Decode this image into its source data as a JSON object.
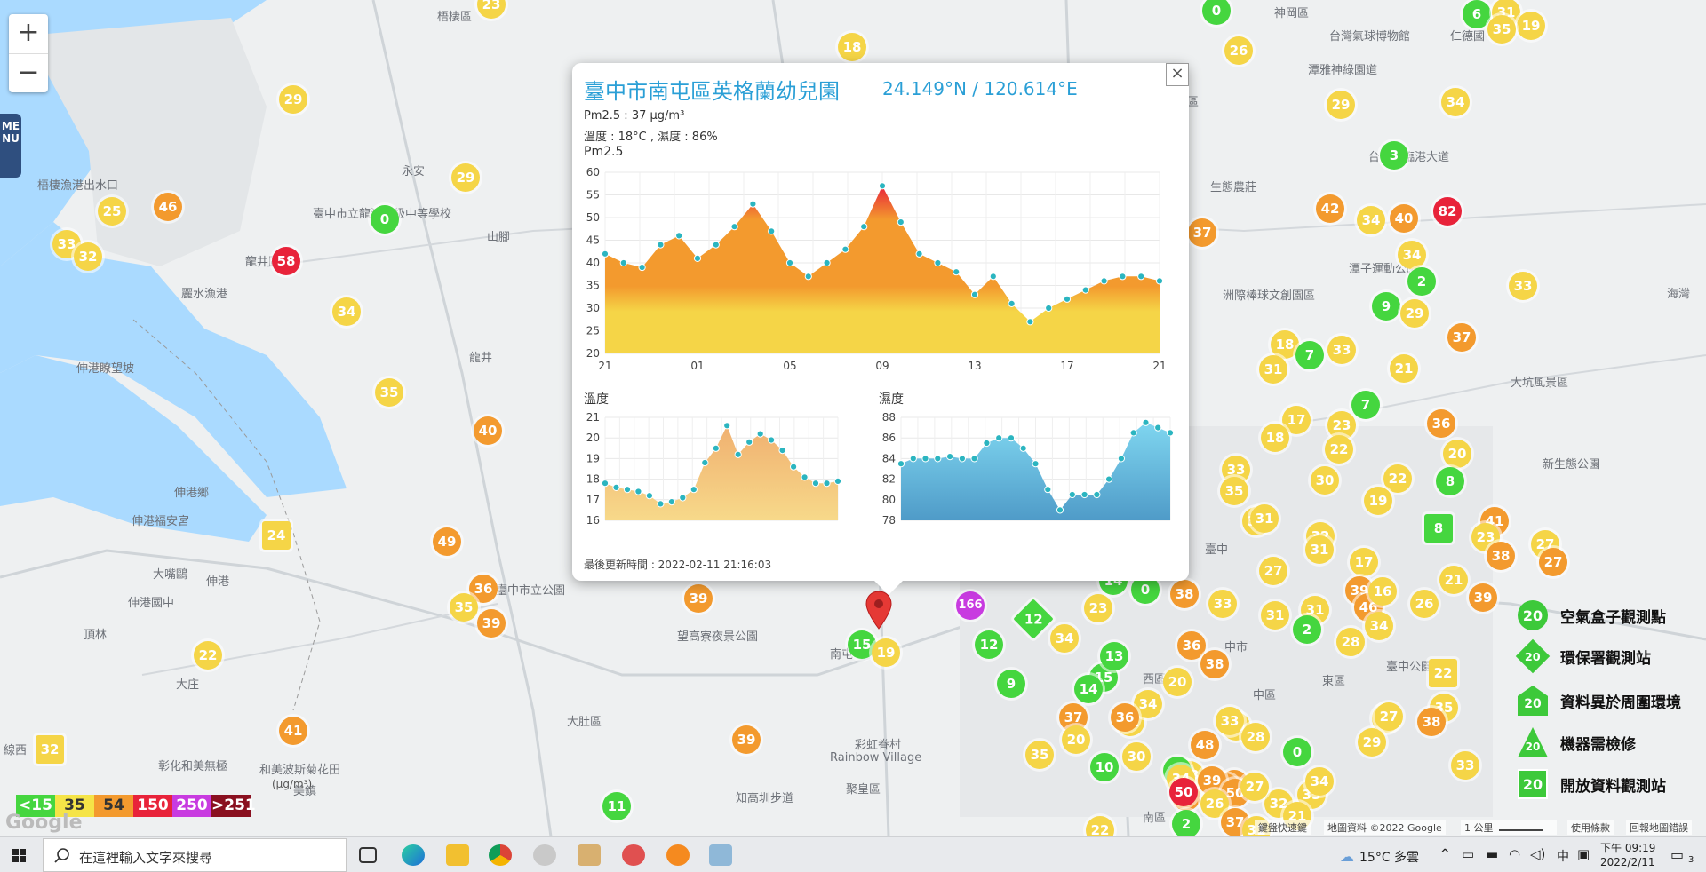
{
  "map": {
    "zoom_in": "+",
    "zoom_out": "−",
    "menu_label": "MENU",
    "place_labels": [
      {
        "name": "梧棲區"
      },
      {
        "name": "神岡區"
      },
      {
        "name": "台灣氣球博物館"
      },
      {
        "name": "仁德國"
      },
      {
        "name": "潭雅神綠園道"
      },
      {
        "name": "生態農莊"
      },
      {
        "name": "台中港臨港大道"
      },
      {
        "name": "梧棲漁港出水口"
      },
      {
        "name": "永安"
      },
      {
        "name": "龍井區"
      },
      {
        "name": "臺中市立龍津高級中等學校"
      },
      {
        "name": "麗水漁港"
      },
      {
        "name": "山腳"
      },
      {
        "name": "龍井"
      },
      {
        "name": "伸港瞭望坡"
      },
      {
        "name": "洲際棒球文創園區"
      },
      {
        "name": "潭子運動公園"
      },
      {
        "name": "伸港鄉"
      },
      {
        "name": "伸港福安宮"
      },
      {
        "name": "大嘴鷗"
      },
      {
        "name": "伸港"
      },
      {
        "name": "伸港國中"
      },
      {
        "name": "頂林"
      },
      {
        "name": "大庄"
      },
      {
        "name": "望高寮夜景公園"
      },
      {
        "name": "南屯"
      },
      {
        "name": "大肚區"
      },
      {
        "name": "彩虹眷村"
      },
      {
        "name": "Rainbow Village"
      },
      {
        "name": "聚皇區"
      },
      {
        "name": "知高圳步道"
      },
      {
        "name": "彰化和美無極"
      },
      {
        "name": "和美波斯菊花田"
      },
      {
        "name": "線西"
      },
      {
        "name": "美鎮"
      },
      {
        "name": "臺中"
      },
      {
        "name": "中市"
      },
      {
        "name": "西區"
      },
      {
        "name": "中區"
      },
      {
        "name": "東區"
      },
      {
        "name": "南區"
      },
      {
        "name": "大坑風景區"
      },
      {
        "name": "新生態公園"
      },
      {
        "name": "臺中公園"
      },
      {
        "name": "海灣"
      },
      {
        "name": "北屯區"
      },
      {
        "name": "臺中市立公園"
      }
    ],
    "markers": [
      {
        "v": "23",
        "c": "#f5d547",
        "s": "circle"
      },
      {
        "v": "0",
        "c": "#45d63f",
        "s": "circle"
      },
      {
        "v": "6",
        "c": "#45d63f",
        "s": "circle"
      },
      {
        "v": "31",
        "c": "#f5d547",
        "s": "circle"
      },
      {
        "v": "19",
        "c": "#f5d547",
        "s": "circle"
      },
      {
        "v": "35",
        "c": "#f5d547",
        "s": "circle"
      },
      {
        "v": "26",
        "c": "#f5d547",
        "s": "circle"
      },
      {
        "v": "18",
        "c": "#f5d547",
        "s": "circle"
      },
      {
        "v": "29",
        "c": "#f5d547",
        "s": "circle"
      },
      {
        "v": "29",
        "c": "#f5d547",
        "s": "circle"
      },
      {
        "v": "34",
        "c": "#f5d547",
        "s": "circle"
      },
      {
        "v": "3",
        "c": "#45d63f",
        "s": "circle"
      },
      {
        "v": "29",
        "c": "#f5d547",
        "s": "circle"
      },
      {
        "v": "25",
        "c": "#f5d547",
        "s": "circle"
      },
      {
        "v": "46",
        "c": "#f39a2e",
        "s": "circle"
      },
      {
        "v": "0",
        "c": "#45d63f",
        "s": "circle"
      },
      {
        "v": "33",
        "c": "#f5d547",
        "s": "circle"
      },
      {
        "v": "32",
        "c": "#f5d547",
        "s": "circle"
      },
      {
        "v": "58",
        "c": "#e8233a",
        "s": "circle"
      },
      {
        "v": "34",
        "c": "#f5d547",
        "s": "circle"
      },
      {
        "v": "35",
        "c": "#f5d547",
        "s": "circle"
      },
      {
        "v": "40",
        "c": "#f39a2e",
        "s": "circle"
      },
      {
        "v": "42",
        "c": "#f39a2e",
        "s": "circle"
      },
      {
        "v": "34",
        "c": "#f5d547",
        "s": "circle"
      },
      {
        "v": "40",
        "c": "#f39a2e",
        "s": "circle"
      },
      {
        "v": "82",
        "c": "#e8233a",
        "s": "circle"
      },
      {
        "v": "37",
        "c": "#f39a2e",
        "s": "circle"
      },
      {
        "v": "34",
        "c": "#f5d547",
        "s": "circle"
      },
      {
        "v": "2",
        "c": "#45d63f",
        "s": "circle"
      },
      {
        "v": "9",
        "c": "#45d63f",
        "s": "circle"
      },
      {
        "v": "29",
        "c": "#f5d547",
        "s": "circle"
      },
      {
        "v": "33",
        "c": "#f5d547",
        "s": "circle"
      },
      {
        "v": "37",
        "c": "#f39a2e",
        "s": "circle"
      },
      {
        "v": "18",
        "c": "#f5d547",
        "s": "circle"
      },
      {
        "v": "7",
        "c": "#45d63f",
        "s": "circle"
      },
      {
        "v": "33",
        "c": "#f5d547",
        "s": "circle"
      },
      {
        "v": "21",
        "c": "#f5d547",
        "s": "circle"
      },
      {
        "v": "31",
        "c": "#f5d547",
        "s": "circle"
      },
      {
        "v": "7",
        "c": "#45d63f",
        "s": "circle"
      },
      {
        "v": "17",
        "c": "#f5d547",
        "s": "circle"
      },
      {
        "v": "18",
        "c": "#f5d547",
        "s": "circle"
      },
      {
        "v": "23",
        "c": "#f5d547",
        "s": "circle"
      },
      {
        "v": "22",
        "c": "#f5d547",
        "s": "circle"
      },
      {
        "v": "36",
        "c": "#f39a2e",
        "s": "circle"
      },
      {
        "v": "20",
        "c": "#f5d547",
        "s": "circle"
      },
      {
        "v": "33",
        "c": "#f5d547",
        "s": "circle"
      },
      {
        "v": "35",
        "c": "#f5d547",
        "s": "circle"
      },
      {
        "v": "30",
        "c": "#f5d547",
        "s": "circle"
      },
      {
        "v": "22",
        "c": "#f5d547",
        "s": "circle"
      },
      {
        "v": "8",
        "c": "#45d63f",
        "s": "circle"
      },
      {
        "v": "19",
        "c": "#f5d547",
        "s": "circle"
      },
      {
        "v": "33",
        "c": "#f5d547",
        "s": "circle"
      },
      {
        "v": "31",
        "c": "#f5d547",
        "s": "circle"
      },
      {
        "v": "41",
        "c": "#f39a2e",
        "s": "circle"
      },
      {
        "v": "23",
        "c": "#f5d547",
        "s": "circle"
      },
      {
        "v": "27",
        "c": "#f5d547",
        "s": "circle"
      },
      {
        "v": "8",
        "c": "#45d63f",
        "s": "square"
      },
      {
        "v": "38",
        "c": "#f39a2e",
        "s": "circle"
      },
      {
        "v": "27",
        "c": "#f39a2e",
        "s": "circle"
      },
      {
        "v": "32",
        "c": "#f5d547",
        "s": "circle"
      },
      {
        "v": "31",
        "c": "#f5d547",
        "s": "circle"
      },
      {
        "v": "17",
        "c": "#f5d547",
        "s": "circle"
      },
      {
        "v": "21",
        "c": "#f5d547",
        "s": "circle"
      },
      {
        "v": "39",
        "c": "#f39a2e",
        "s": "circle"
      },
      {
        "v": "31",
        "c": "#f5d547",
        "s": "circle"
      },
      {
        "v": "39",
        "c": "#f39a2e",
        "s": "circle"
      },
      {
        "v": "49",
        "c": "#f39a2e",
        "s": "circle"
      },
      {
        "v": "24",
        "c": "#f5d547",
        "s": "square"
      },
      {
        "v": "36",
        "c": "#f39a2e",
        "s": "circle"
      },
      {
        "v": "35",
        "c": "#f5d547",
        "s": "circle"
      },
      {
        "v": "39",
        "c": "#f39a2e",
        "s": "circle"
      },
      {
        "v": "39",
        "c": "#f39a2e",
        "s": "circle"
      },
      {
        "v": "22",
        "c": "#f5d547",
        "s": "circle"
      },
      {
        "v": "41",
        "c": "#f39a2e",
        "s": "circle"
      },
      {
        "v": "32",
        "c": "#f5d547",
        "s": "square"
      },
      {
        "v": "39",
        "c": "#f39a2e",
        "s": "circle"
      },
      {
        "v": "11",
        "c": "#45d63f",
        "s": "circle"
      },
      {
        "v": "15",
        "c": "#45d63f",
        "s": "circle"
      },
      {
        "v": "19",
        "c": "#f5d547",
        "s": "circle"
      },
      {
        "v": "166",
        "c": "#c83be0",
        "s": "circle"
      },
      {
        "v": "12",
        "c": "#45d63f",
        "s": "diamond"
      },
      {
        "v": "23",
        "c": "#f5d547",
        "s": "circle"
      },
      {
        "v": "14",
        "c": "#45d63f",
        "s": "circle"
      },
      {
        "v": "0",
        "c": "#45d63f",
        "s": "circle"
      },
      {
        "v": "38",
        "c": "#f39a2e",
        "s": "circle"
      },
      {
        "v": "33",
        "c": "#f5d547",
        "s": "circle"
      },
      {
        "v": "31",
        "c": "#f5d547",
        "s": "circle"
      },
      {
        "v": "2",
        "c": "#45d63f",
        "s": "circle"
      },
      {
        "v": "46",
        "c": "#f39a2e",
        "s": "circle"
      },
      {
        "v": "27",
        "c": "#f5d547",
        "s": "circle"
      },
      {
        "v": "16",
        "c": "#f5d547",
        "s": "circle"
      },
      {
        "v": "26",
        "c": "#f5d547",
        "s": "circle"
      },
      {
        "v": "34",
        "c": "#f5d547",
        "s": "circle"
      },
      {
        "v": "28",
        "c": "#f5d547",
        "s": "circle"
      },
      {
        "v": "22",
        "c": "#f5d547",
        "s": "square"
      },
      {
        "v": "35",
        "c": "#f5d547",
        "s": "circle"
      },
      {
        "v": "12",
        "c": "#45d63f",
        "s": "circle"
      },
      {
        "v": "9",
        "c": "#45d63f",
        "s": "circle"
      },
      {
        "v": "34",
        "c": "#f5d547",
        "s": "circle"
      },
      {
        "v": "15",
        "c": "#45d63f",
        "s": "circle"
      },
      {
        "v": "13",
        "c": "#45d63f",
        "s": "circle"
      },
      {
        "v": "37",
        "c": "#f39a2e",
        "s": "circle"
      },
      {
        "v": "32",
        "c": "#f5d547",
        "s": "circle"
      },
      {
        "v": "34",
        "c": "#f5d547",
        "s": "circle"
      },
      {
        "v": "36",
        "c": "#f39a2e",
        "s": "circle"
      },
      {
        "v": "14",
        "c": "#45d63f",
        "s": "circle"
      },
      {
        "v": "38",
        "c": "#f39a2e",
        "s": "circle"
      },
      {
        "v": "29",
        "c": "#f5d547",
        "s": "circle"
      },
      {
        "v": "20",
        "c": "#f5d547",
        "s": "circle"
      },
      {
        "v": "36",
        "c": "#f39a2e",
        "s": "circle"
      },
      {
        "v": "20",
        "c": "#f5d547",
        "s": "circle"
      },
      {
        "v": "33",
        "c": "#f5d547",
        "s": "circle"
      },
      {
        "v": "10",
        "c": "#45d63f",
        "s": "circle"
      },
      {
        "v": "30",
        "c": "#f5d547",
        "s": "circle"
      },
      {
        "v": "35",
        "c": "#f5d547",
        "s": "circle"
      },
      {
        "v": "33",
        "c": "#f5d547",
        "s": "circle"
      },
      {
        "v": "28",
        "c": "#f5d547",
        "s": "circle"
      },
      {
        "v": "46",
        "c": "#f39a2e",
        "s": "circle"
      },
      {
        "v": "16",
        "c": "#f5d547",
        "s": "circle"
      },
      {
        "v": "29",
        "c": "#f5d547",
        "s": "circle"
      },
      {
        "v": "48",
        "c": "#f39a2e",
        "s": "circle"
      },
      {
        "v": "47",
        "c": "#f39a2e",
        "s": "circle"
      },
      {
        "v": "4",
        "c": "#45d63f",
        "s": "circle"
      },
      {
        "v": "0",
        "c": "#45d63f",
        "s": "circle"
      },
      {
        "v": "27",
        "c": "#f5d547",
        "s": "circle"
      },
      {
        "v": "38",
        "c": "#f39a2e",
        "s": "circle"
      },
      {
        "v": "35",
        "c": "#f5d547",
        "s": "circle"
      },
      {
        "v": "33",
        "c": "#f5d547",
        "s": "circle"
      },
      {
        "v": "34",
        "c": "#f5d547",
        "s": "circle"
      },
      {
        "v": "47",
        "c": "#f39a2e",
        "s": "circle"
      },
      {
        "v": "2",
        "c": "#45d63f",
        "s": "circle"
      },
      {
        "v": "32",
        "c": "#f5d547",
        "s": "circle"
      },
      {
        "v": "34",
        "c": "#f5d547",
        "s": "circle"
      },
      {
        "v": "39",
        "c": "#f39a2e",
        "s": "circle"
      },
      {
        "v": "50",
        "c": "#f39a2e",
        "s": "circle"
      },
      {
        "v": "27",
        "c": "#f5d547",
        "s": "circle"
      },
      {
        "v": "50",
        "c": "#e8233a",
        "s": "circle"
      },
      {
        "v": "26",
        "c": "#f5d547",
        "s": "circle"
      },
      {
        "v": "37",
        "c": "#f39a2e",
        "s": "circle"
      },
      {
        "v": "21",
        "c": "#f5d547",
        "s": "circle"
      },
      {
        "v": "31",
        "c": "#f5d547",
        "s": "circle"
      },
      {
        "v": "22",
        "c": "#f5d547",
        "s": "circle"
      }
    ]
  },
  "popup": {
    "close": "×",
    "title": "臺中市南屯區英格蘭幼兒園",
    "coords": "24.149°N / 120.614°E",
    "pm25_line": "Pm2.5 : 37 μg/m³",
    "temp_humidity_line": "溫度 : 18°C , 濕度 : 86%",
    "pm25_label": "Pm2.5",
    "temp_label": "溫度",
    "humidity_label": "濕度",
    "updated": "最後更新時間 : 2022-02-11 21:16:03"
  },
  "legend": {
    "scale": [
      {
        "label": "<15",
        "color": "#45d63f",
        "text": "#ffffff"
      },
      {
        "label": "35",
        "color": "#f5e447",
        "text": "#333333"
      },
      {
        "label": "54",
        "color": "#f39a2e",
        "text": "#333333"
      },
      {
        "label": "150",
        "color": "#e8233a",
        "text": "#ffffff"
      },
      {
        "label": "250",
        "color": "#c83be0",
        "text": "#ffffff"
      },
      {
        "label": ">251",
        "color": "#8a1020",
        "text": "#ffffff"
      }
    ],
    "unit": "(μg/m³)",
    "station_types": [
      {
        "label": "空氣盒子觀測點",
        "symbol": "20",
        "shape": "circle"
      },
      {
        "label": "環保署觀測站",
        "symbol": "20",
        "shape": "diamond"
      },
      {
        "label": "資料異於周圍環境",
        "symbol": "20",
        "shape": "house"
      },
      {
        "label": "機器需檢修",
        "symbol": "20",
        "shape": "triangle"
      },
      {
        "label": "開放資料觀測站",
        "symbol": "20",
        "shape": "square"
      }
    ]
  },
  "attribution": {
    "shortcuts": "鍵盤快速鍵",
    "map_data": "地圖資料 ©2022 Google",
    "scale": "1 公里",
    "terms": "使用條款",
    "report": "回報地圖錯誤",
    "logo": "Google"
  },
  "taskbar": {
    "search_placeholder": "在這裡輸入文字來搜尋",
    "weather": "15°C 多雲",
    "ime": "中",
    "time": "下午 09:19",
    "date": "2022/2/11",
    "notification_count": "3"
  },
  "chart_data": [
    {
      "type": "area",
      "title": "Pm2.5",
      "x_tick_labels": [
        "21",
        "01",
        "05",
        "09",
        "13",
        "17",
        "21"
      ],
      "ylim": [
        20,
        60
      ],
      "y_ticks": [
        20,
        25,
        30,
        35,
        40,
        45,
        50,
        55,
        60
      ],
      "series": [
        {
          "values": [
            42,
            40,
            39,
            44,
            46,
            41,
            44,
            48,
            53,
            47,
            40,
            37,
            40,
            43,
            48,
            57,
            49,
            42,
            40,
            38,
            33,
            37,
            31,
            27,
            30,
            32,
            34,
            36,
            37,
            37,
            36
          ]
        }
      ]
    },
    {
      "type": "area",
      "title": "溫度",
      "ylim": [
        16,
        21
      ],
      "y_ticks": [
        16,
        17,
        18,
        19,
        20,
        21
      ],
      "series": [
        {
          "values": [
            17.8,
            17.6,
            17.5,
            17.4,
            17.2,
            16.8,
            16.9,
            17.1,
            17.5,
            18.8,
            19.5,
            20.6,
            19.2,
            19.8,
            20.2,
            19.9,
            19.4,
            18.6,
            18.1,
            17.8,
            17.8,
            17.9
          ]
        }
      ]
    },
    {
      "type": "area",
      "title": "濕度",
      "ylim": [
        78,
        88
      ],
      "y_ticks": [
        78,
        80,
        82,
        84,
        86,
        88
      ],
      "series": [
        {
          "values": [
            83.5,
            84,
            84,
            84,
            84.2,
            84,
            84,
            85.5,
            86,
            86,
            85,
            83.5,
            81,
            79,
            80.5,
            80.5,
            80.5,
            82,
            84,
            86.5,
            87.5,
            87,
            86.5
          ]
        }
      ]
    }
  ]
}
